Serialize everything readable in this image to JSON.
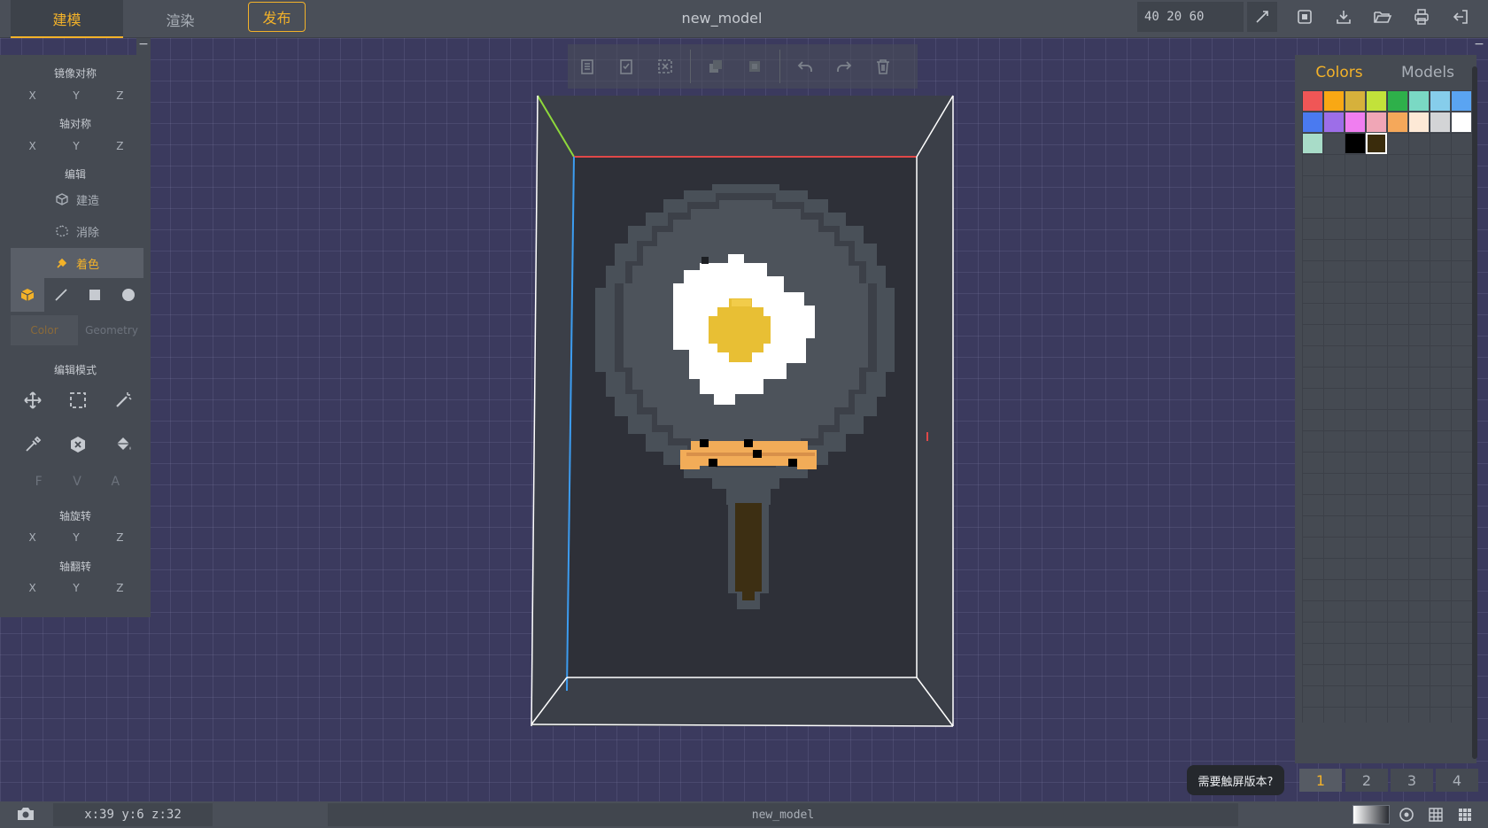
{
  "top_bar": {
    "tabs": [
      {
        "label": "建模",
        "active": true
      },
      {
        "label": "渲染",
        "active": false
      }
    ],
    "publish_label": "发布",
    "model_title": "new_model",
    "dimensions_value": "40 20 60",
    "right_icons": [
      "save-icon",
      "download-icon",
      "folder-open-icon",
      "print-icon",
      "exit-icon"
    ]
  },
  "left_panel": {
    "collapse_label": "−",
    "mirror_title": "镜像对称",
    "mirror_axes": [
      "X",
      "Y",
      "Z"
    ],
    "axis_sym_title": "轴对称",
    "axis_sym_axes": [
      "X",
      "Y",
      "Z"
    ],
    "edit_title": "编辑",
    "edit_items": [
      {
        "label": "建造",
        "icon": "build-icon",
        "active": false
      },
      {
        "label": "消除",
        "icon": "erase-icon",
        "active": false
      },
      {
        "label": "着色",
        "icon": "paint-icon",
        "active": true
      }
    ],
    "shapes": [
      "cube-icon",
      "line-icon",
      "square-icon",
      "circle-icon"
    ],
    "color_tab": "Color",
    "geometry_tab": "Geometry",
    "edit_mode_title": "编辑模式",
    "tools_row1": [
      "move-icon",
      "select-box-icon",
      "magic-wand-icon"
    ],
    "tools_row2": [
      "eyedropper-icon",
      "cancel-icon",
      "fill-bucket-icon"
    ],
    "fva": [
      "F",
      "V",
      "A"
    ],
    "rotate_title": "轴旋转",
    "rotate_axes": [
      "X",
      "Y",
      "Z"
    ],
    "flip_title": "轴翻转",
    "flip_axes": [
      "X",
      "Y",
      "Z"
    ]
  },
  "edit_toolbar": [
    "copy-icon",
    "paste-icon",
    "clear-selection-icon",
    "duplicate-icon",
    "duplicate-alt-icon",
    "undo-icon",
    "redo-icon",
    "trash-icon"
  ],
  "right_panel": {
    "collapse_label": "−",
    "tabs": [
      {
        "label": "Colors",
        "active": true
      },
      {
        "label": "Models",
        "active": false
      }
    ],
    "swatches": [
      [
        "#f05656",
        "#f9a814",
        "#d6b13b",
        "#c2e23a",
        "#2eb04a",
        "#7ad9c4",
        "#86cdeb",
        "#5aa4f2"
      ],
      [
        "#4a7af0",
        "#9d6ee8",
        "#f07ef0",
        "#f0a6b6",
        "#f5a85a",
        "#fde9d6",
        "#d3d4d6",
        "#ffffff"
      ],
      [
        "#a8dcc8",
        "#454a52",
        "#000000",
        "#3a2c0c"
      ]
    ],
    "selected_swatch": "#3a2c0c",
    "pages": [
      "1",
      "2",
      "3",
      "4"
    ],
    "active_page": "1"
  },
  "tooltip": "需要触屏版本?",
  "status_bar": {
    "coords": "x:39 y:6 z:32",
    "model_name": "new_model"
  },
  "colors": {
    "accent": "#f3b229",
    "panel": "#454a52",
    "bar": "#4a4f58",
    "viewport": "#3b3a5e",
    "pan": "#495058",
    "pan_inner": "#3c4048",
    "egg_white": "#ffffff",
    "yolk": "#e8bf34",
    "bacon": "#f2ac58",
    "handle": "#3d2f13"
  }
}
